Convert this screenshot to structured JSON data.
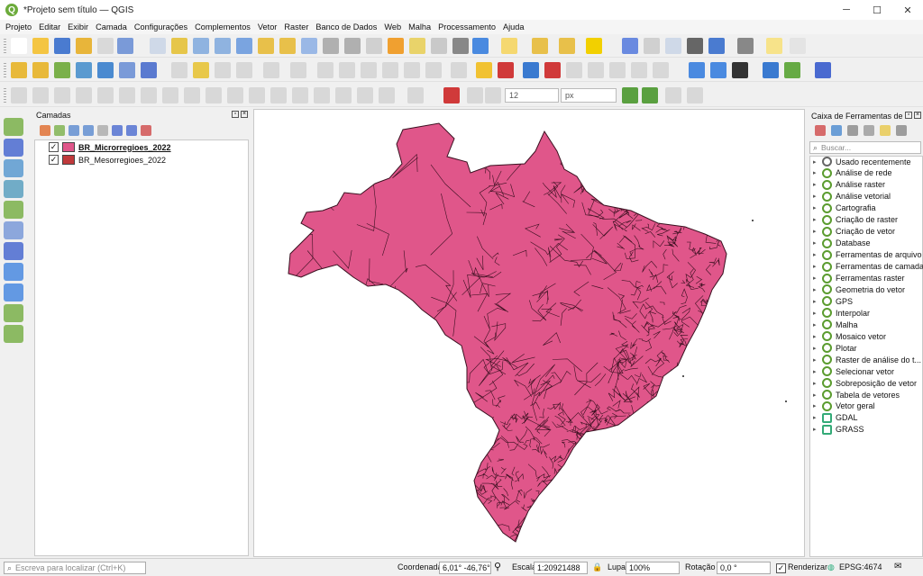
{
  "window": {
    "title": "*Projeto sem título — QGIS",
    "logo": "Q"
  },
  "window_controls": {
    "minimize": "─",
    "maximize": "☐",
    "close": "✕"
  },
  "menu": [
    "Projeto",
    "Editar",
    "Exibir",
    "Camada",
    "Configurações",
    "Complementos",
    "Vetor",
    "Raster",
    "Banco de Dados",
    "Web",
    "Malha",
    "Processamento",
    "Ajuda"
  ],
  "snapping": {
    "tolerance": "12",
    "unit": "px"
  },
  "layers_panel": {
    "title": "Camadas",
    "layers": [
      {
        "name": "BR_Microrregioes_2022",
        "checked": "✓",
        "color": "#e0568a"
      },
      {
        "name": "BR_Mesorregioes_2022",
        "checked": "✓",
        "color": "#c0393b"
      }
    ]
  },
  "toolbox": {
    "title": "Caixa de Ferramentas de ...",
    "search_placeholder": "Buscar...",
    "items": [
      "Usado recentemente",
      "Análise de rede",
      "Análise raster",
      "Análise vetorial",
      "Cartografia",
      "Criação de raster",
      "Criação de vetor",
      "Database",
      "Ferramentas de arquivo",
      "Ferramentas de camada",
      "Ferramentas raster",
      "Geometria do vetor",
      "GPS",
      "Interpolar",
      "Malha",
      "Mosaico vetor",
      "Plotar",
      "Raster de análise do t...",
      "Selecionar vetor",
      "Sobreposição de vetor",
      "Tabela de vetores",
      "Vetor geral",
      "GDAL",
      "GRASS"
    ]
  },
  "map": {
    "fill_color": "#e0568a",
    "stroke_color": "#3a1020"
  },
  "status": {
    "locator_placeholder": "Escreva para localizar (Ctrl+K)",
    "coord_label": "Coordenada",
    "coord_value": "6,01° -46,76°",
    "scale_label": "Escala",
    "scale_value": "1:20921488",
    "magnifier_label": "Lupa",
    "magnifier_value": "100%",
    "rotation_label": "Rotação",
    "rotation_value": "0,0 °",
    "render_label": "Renderizar",
    "render_checked": "✓",
    "crs": "EPSG:4674"
  }
}
